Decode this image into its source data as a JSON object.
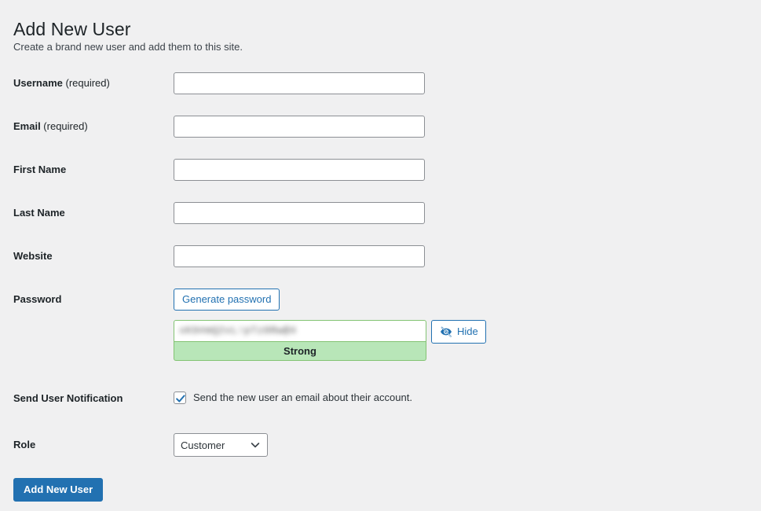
{
  "page": {
    "title": "Add New User",
    "subtitle": "Create a brand new user and add them to this site."
  },
  "fields": {
    "username": {
      "label": "Username",
      "required_suffix": " (required)",
      "value": "",
      "placeholder": ""
    },
    "email": {
      "label": "Email",
      "required_suffix": " (required)",
      "value": "",
      "placeholder": ""
    },
    "first_name": {
      "label": "First Name",
      "value": "",
      "placeholder": ""
    },
    "last_name": {
      "label": "Last Name",
      "value": "",
      "placeholder": ""
    },
    "website": {
      "label": "Website",
      "value": "",
      "placeholder": ""
    }
  },
  "password": {
    "label": "Password",
    "generate_button_label": "Generate password",
    "value_masked": "xK9#mQ2vL!pTz8Rw@4",
    "strength_label": "Strong",
    "hide_button_label": "Hide",
    "hide_icon": "eye-slash-icon"
  },
  "notification": {
    "label": "Send User Notification",
    "checkbox_label": "Send the new user an email about their account.",
    "checked": true
  },
  "role": {
    "label": "Role",
    "selected": "Customer",
    "arrow_icon": "chevron-down-icon"
  },
  "submit": {
    "label": "Add New User"
  },
  "colors": {
    "background": "#f0f0f1",
    "accent_blue": "#2271b1",
    "strength_green_bg": "#b8e6b8",
    "strength_green_border": "#83c373",
    "input_border": "#8c8f94",
    "text": "#1d2327"
  }
}
